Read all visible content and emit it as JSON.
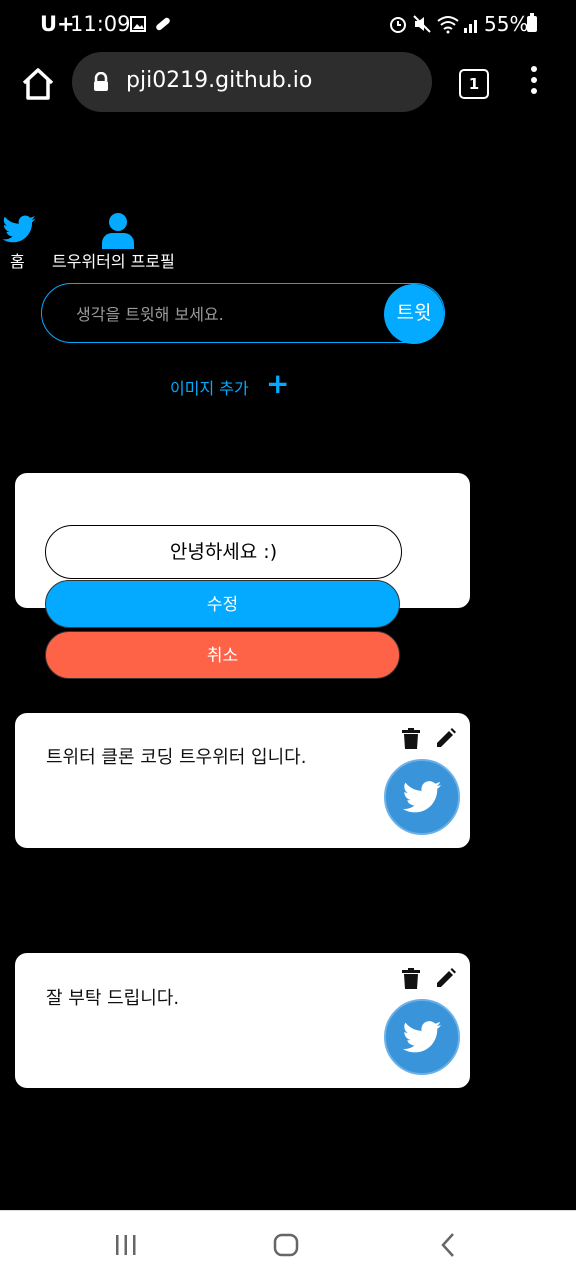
{
  "status_bar": {
    "carrier": "U+",
    "time": "11:09",
    "battery": "55%"
  },
  "browser": {
    "url": "pji0219.github.io",
    "tab_count": "1"
  },
  "nav": {
    "home_label": "홈",
    "profile_label": "트우위터의 프로필"
  },
  "tweet_form": {
    "placeholder": "생각을 트윗해 보세요.",
    "submit_label": "트윗",
    "add_image_label": "이미지 추가",
    "add_image_plus": "+"
  },
  "editing_tweet": {
    "value": "안녕하세요 :)",
    "update_label": "수정",
    "cancel_label": "취소"
  },
  "tweets": [
    {
      "text": "트위터 클론 코딩 트우위터 입니다.",
      "image_icon": "twitter-bird-icon"
    },
    {
      "text": "잘 부탁 드립니다.",
      "image_icon": "twitter-bird-icon"
    }
  ],
  "colors": {
    "accent": "#04aaff",
    "cancel": "#ff6347",
    "card": "#ffffff",
    "background": "#000000",
    "tweet_image": "#3a94d9"
  }
}
